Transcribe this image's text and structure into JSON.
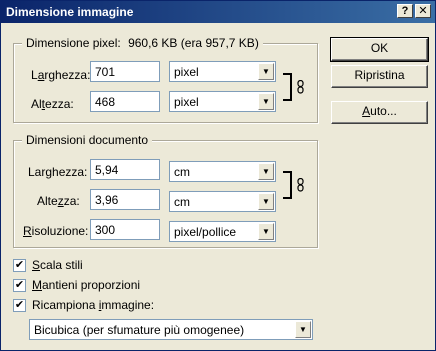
{
  "window": {
    "title": "Dimensione immagine",
    "help_label": "?",
    "close_label": "✕"
  },
  "pixel_group": {
    "legend": "Dimensione pixel:",
    "size": "960,6 KB (era 957,7 KB)",
    "width": {
      "label_pre": "L",
      "label_ul": "a",
      "label_post": "rghezza:",
      "value": "701",
      "unit": "pixel"
    },
    "height": {
      "label_pre": "Al",
      "label_ul": "t",
      "label_post": "ezza:",
      "value": "468",
      "unit": "pixel"
    }
  },
  "doc_group": {
    "legend": "Dimensioni documento",
    "width": {
      "label_pre": "Lar",
      "label_ul": "g",
      "label_post": "hezza:",
      "value": "5,94",
      "unit": "cm"
    },
    "height": {
      "label_pre": "Alte",
      "label_ul": "z",
      "label_post": "za:",
      "value": "3,96",
      "unit": "cm"
    },
    "resolution": {
      "label_pre": "",
      "label_ul": "R",
      "label_post": "isoluzione:",
      "value": "300",
      "unit": "pixel/pollice"
    }
  },
  "buttons": {
    "ok": "OK",
    "reset": "Ripristina",
    "auto_pre": "",
    "auto_ul": "A",
    "auto_post": "uto..."
  },
  "options": {
    "scale_styles": {
      "ul": "S",
      "rest": "cala stili",
      "checked": true
    },
    "constrain": {
      "ul": "M",
      "rest": "antieni proporzioni",
      "checked": true
    },
    "resample": {
      "ul": "",
      "pre": "Ricampiona ",
      "ul2": "i",
      "rest": "mmagine:",
      "checked": true
    }
  },
  "resample_method": "Bicubica (per sfumature più omogenee)",
  "check_mark": "✔",
  "dropdown_arrow": "▼",
  "link_icon": "chain-link-icon"
}
